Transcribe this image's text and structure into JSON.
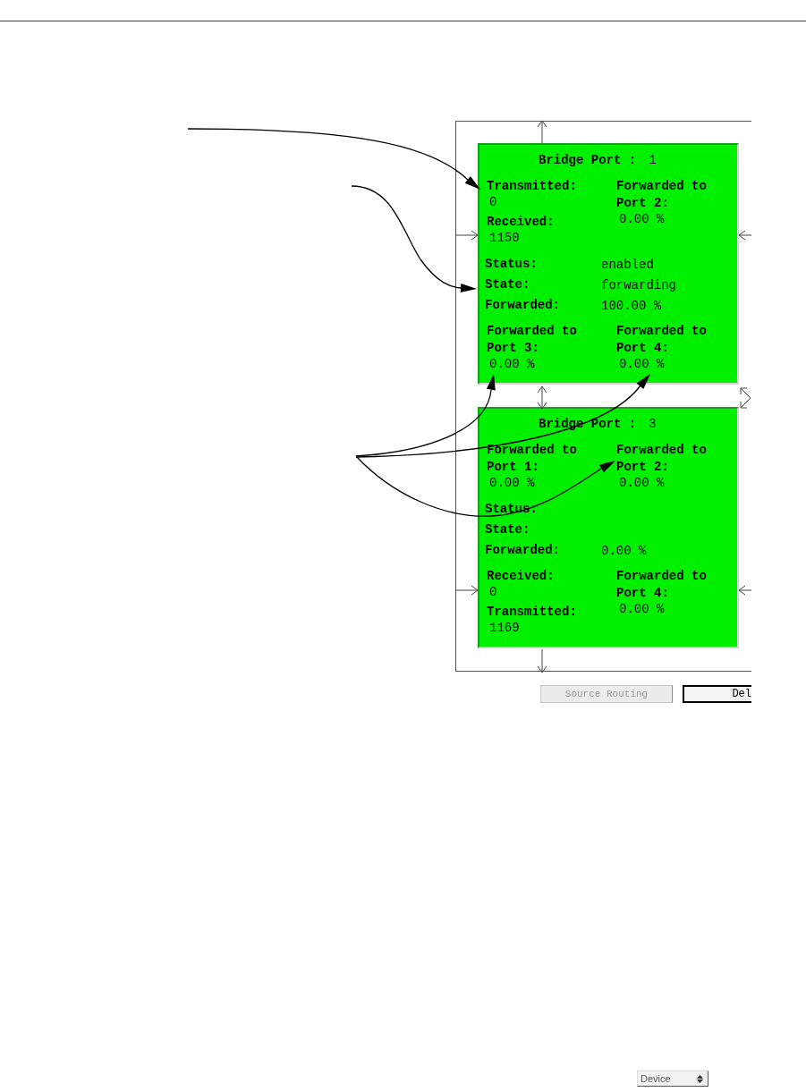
{
  "panels": [
    {
      "title": "Bridge Port :",
      "port": "1",
      "top_left": [
        {
          "label": "Transmitted:",
          "value": "0"
        },
        {
          "label": "Received:",
          "value": "1150"
        }
      ],
      "top_right": [
        {
          "label": "Forwarded to Port 2:",
          "value": "0.00 %"
        }
      ],
      "summary": [
        {
          "label": "Status:",
          "value": "enabled"
        },
        {
          "label": "State:",
          "value": "forwarding"
        },
        {
          "label": "Forwarded:",
          "value": "100.00 %"
        }
      ],
      "bottom_left": [
        {
          "label": "Forwarded to Port 3:",
          "value": "0.00 %"
        }
      ],
      "bottom_right": [
        {
          "label": "Forwarded to Port 4:",
          "value": "0.00 %"
        }
      ]
    },
    {
      "title": "Bridge Port :",
      "port": "3",
      "top_left": [
        {
          "label": "Forwarded to Port 1:",
          "value": "0.00 %"
        }
      ],
      "top_right": [
        {
          "label": "Forwarded to Port 2:",
          "value": "0.00 %"
        }
      ],
      "summary": [
        {
          "label": "Status:"
        },
        {
          "label": "State:"
        },
        {
          "label": "Forwarded:",
          "value": "0.00 %"
        }
      ],
      "bottom_left": [
        {
          "label": "Received:",
          "value": "0"
        },
        {
          "label": "Transmitted:",
          "value": "1169"
        }
      ],
      "bottom_right": [
        {
          "label": "Forwarded to Port 4:",
          "value": "0.00 %"
        }
      ]
    }
  ],
  "buttons": [
    {
      "label": "Source Routing",
      "disabled": true
    },
    {
      "label": "Del",
      "disabled": false
    }
  ],
  "view_select": {
    "value": "Device"
  }
}
